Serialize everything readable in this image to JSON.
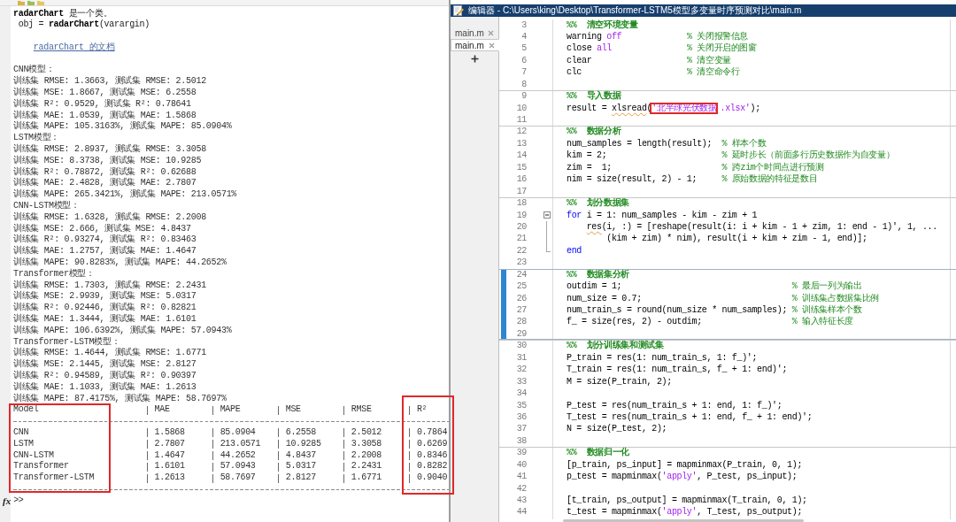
{
  "command_window": {
    "help": [
      {
        "kind": "heading",
        "text": "**radarChart** 是一个类。"
      },
      {
        "kind": "signature",
        "text": "obj = **radarChart**(varargin)"
      },
      {
        "kind": "link",
        "text": "radarChart 的文档"
      }
    ],
    "results": [
      {
        "title": "CNN模型：",
        "lines": [
          "训练集 RMSE: 1.3663, 测试集 RMSE: 2.5012",
          "训练集 MSE: 1.8667, 测试集 MSE: 6.2558",
          "训练集 R²: 0.9529, 测试集 R²: 0.78641",
          "训练集 MAE: 1.0539, 测试集 MAE: 1.5868",
          "训练集 MAPE: 105.3163%, 测试集 MAPE: 85.0904%"
        ]
      },
      {
        "title": "LSTM模型：",
        "lines": [
          "训练集 RMSE: 2.8937, 测试集 RMSE: 3.3058",
          "训练集 MSE: 8.3738, 测试集 MSE: 10.9285",
          "训练集 R²: 0.78872, 测试集 R²: 0.62688",
          "训练集 MAE: 2.4828, 测试集 MAE: 2.7807",
          "训练集 MAPE: 265.3421%, 测试集 MAPE: 213.0571%"
        ]
      },
      {
        "title": "CNN-LSTM模型：",
        "lines": [
          "训练集 RMSE: 1.6328, 测试集 RMSE: 2.2008",
          "训练集 MSE: 2.666, 测试集 MSE: 4.8437",
          "训练集 R²: 0.93274, 测试集 R²: 0.83463",
          "训练集 MAE: 1.2757, 测试集 MAE: 1.4647",
          "训练集 MAPE: 90.8283%, 测试集 MAPE: 44.2652%"
        ]
      },
      {
        "title": "Transformer模型：",
        "lines": [
          "训练集 RMSE: 1.7303, 测试集 RMSE: 2.2431",
          "训练集 MSE: 2.9939, 测试集 MSE: 5.0317",
          "训练集 R²: 0.92446, 测试集 R²: 0.82821",
          "训练集 MAE: 1.3444, 测试集 MAE: 1.6101",
          "训练集 MAPE: 106.6392%, 测试集 MAPE: 57.0943%"
        ]
      },
      {
        "title": "Transformer-LSTM模型：",
        "lines": [
          "训练集 RMSE: 1.4644, 测试集 RMSE: 1.6771",
          "训练集 MSE: 2.1445, 测试集 MSE: 2.8127",
          "训练集 R²: 0.94589, 测试集 R²: 0.90397",
          "训练集 MAE: 1.1033, 测试集 MAE: 1.2613",
          "训练集 MAPE: 87.4175%, 测试集 MAPE: 58.7697%"
        ]
      }
    ],
    "table": {
      "columns": [
        {
          "label": "Model",
          "highlighted": true
        },
        {
          "label": "MAE",
          "highlighted": false
        },
        {
          "label": "MAPE",
          "highlighted": false
        },
        {
          "label": "MSE",
          "highlighted": false
        },
        {
          "label": "RMSE",
          "highlighted": false
        },
        {
          "label": "R²",
          "highlighted": true
        }
      ],
      "rows": [
        [
          "CNN",
          "1.5868",
          "85.0904",
          "6.2558",
          "2.5012",
          "0.7864"
        ],
        [
          "LSTM",
          "2.7807",
          "213.0571",
          "10.9285",
          "3.3058",
          "0.6269"
        ],
        [
          "CNN-LSTM",
          "1.4647",
          "44.2652",
          "4.8437",
          "2.2008",
          "0.8346"
        ],
        [
          "Transformer",
          "1.6101",
          "57.0943",
          "5.0317",
          "2.2431",
          "0.8282"
        ],
        [
          "Transformer-LSTM",
          "1.2613",
          "58.7697",
          "2.8127",
          "1.6771",
          "0.9040"
        ]
      ]
    },
    "prompt": {
      "button": "fx",
      "text": ">>"
    }
  },
  "editor": {
    "title": "编辑器 - C:\\Users\\king\\Desktop\\Transformer-LSTM5模型多变量时序预测对比\\main.m",
    "tabs": [
      {
        "label": "main.m",
        "selected": false
      },
      {
        "label": "main.m",
        "selected": true
      }
    ],
    "cells": [
      {
        "active": false,
        "lines": [
          {
            "number": "3",
            "code": [
              {
                "kind": "section",
                "text": "%%  清空环境变量"
              }
            ]
          },
          {
            "number": "4",
            "code": [
              {
                "kind": "plain",
                "text": "warning "
              },
              {
                "kind": "string",
                "text": "off             "
              },
              {
                "kind": "comment",
                "text": "% 关闭报警信息"
              }
            ]
          },
          {
            "number": "5",
            "code": [
              {
                "kind": "plain",
                "text": "close "
              },
              {
                "kind": "string",
                "text": "all               "
              },
              {
                "kind": "comment",
                "text": "% 关闭开启的图窗"
              }
            ]
          },
          {
            "number": "6",
            "code": [
              {
                "kind": "plain",
                "text": "clear                   "
              },
              {
                "kind": "comment",
                "text": "% 清空变量"
              }
            ]
          },
          {
            "number": "7",
            "code": [
              {
                "kind": "plain",
                "text": "clc                     "
              },
              {
                "kind": "comment",
                "text": "% 清空命令行"
              }
            ]
          },
          {
            "number": "8"
          }
        ]
      },
      {
        "active": false,
        "lines": [
          {
            "number": "9",
            "code": [
              {
                "kind": "section",
                "text": "%%  导入数据"
              }
            ]
          },
          {
            "number": "10",
            "code": [
              {
                "kind": "plain",
                "text": "result = "
              },
              {
                "kind": "plain",
                "text": "xlsread",
                "warning": true
              },
              {
                "kind": "plain",
                "text": "("
              },
              {
                "kind": "string",
                "text": "'北半球光伏数据",
                "highlighted": true
              },
              {
                "kind": "string",
                "text": ".xlsx'"
              },
              {
                "kind": "plain",
                "text": ");"
              }
            ]
          },
          {
            "number": "11"
          }
        ]
      },
      {
        "active": false,
        "lines": [
          {
            "number": "12",
            "code": [
              {
                "kind": "section",
                "text": "%%  数据分析"
              }
            ]
          },
          {
            "number": "13",
            "code": [
              {
                "kind": "plain",
                "text": "num_samples = length(result);  "
              },
              {
                "kind": "comment",
                "text": "% 样本个数"
              }
            ]
          },
          {
            "number": "14",
            "code": [
              {
                "kind": "plain",
                "text": "kim = 2;                       "
              },
              {
                "kind": "comment",
                "text": "% 延时步长（前面多行历史数据作为自变量）"
              }
            ]
          },
          {
            "number": "15",
            "code": [
              {
                "kind": "plain",
                "text": "zim =  1;                      "
              },
              {
                "kind": "comment",
                "text": "% 跨zim个时间点进行预测"
              }
            ]
          },
          {
            "number": "16",
            "code": [
              {
                "kind": "plain",
                "text": "nim = size(result, 2) - 1;     "
              },
              {
                "kind": "comment",
                "text": "% 原始数据的特征是数目"
              }
            ]
          },
          {
            "number": "17"
          }
        ]
      },
      {
        "active": false,
        "lines": [
          {
            "number": "18",
            "code": [
              {
                "kind": "section",
                "text": "%%  划分数据集"
              }
            ]
          },
          {
            "number": "19",
            "expanded": true,
            "code": [
              {
                "kind": "keyword",
                "text": "for"
              },
              {
                "kind": "plain",
                "text": " i = 1: num_samples - kim - zim + 1"
              }
            ],
            "children": [
              {
                "number": "20",
                "code": [
                  {
                    "kind": "plain",
                    "text": "    res",
                    "warning": true
                  },
                  {
                    "kind": "plain",
                    "text": "(i, :) = [reshape(result(i: i + kim - 1 + zim, 1: end - 1)', 1, ..."
                  }
                ]
              },
              {
                "number": "21",
                "code": [
                  {
                    "kind": "plain",
                    "text": "        (kim + zim) * nim), result(i + kim + zim - 1, end)];"
                  }
                ]
              },
              {
                "number": "22",
                "code": [
                  {
                    "kind": "keyword",
                    "text": "end"
                  }
                ]
              }
            ]
          },
          {
            "number": "23"
          }
        ]
      },
      {
        "active": true,
        "lines": [
          {
            "number": "24",
            "code": [
              {
                "kind": "section",
                "text": "%%  数据集分析"
              }
            ]
          },
          {
            "number": "25",
            "code": [
              {
                "kind": "plain",
                "text": "outdim = 1;                                  "
              },
              {
                "kind": "comment",
                "text": "% 最后一列为输出"
              }
            ]
          },
          {
            "number": "26",
            "code": [
              {
                "kind": "plain",
                "text": "num_size = 0.7;                              "
              },
              {
                "kind": "comment",
                "text": "% 训练集占数据集比例"
              }
            ]
          },
          {
            "number": "27",
            "code": [
              {
                "kind": "plain",
                "text": "num_train_s = round(num_size * num_samples); "
              },
              {
                "kind": "comment",
                "text": "% 训练集样本个数"
              }
            ]
          },
          {
            "number": "28",
            "code": [
              {
                "kind": "plain",
                "text": "f_ = size(res, 2) - outdim;                  "
              },
              {
                "kind": "comment",
                "text": "% 输入特征长度"
              }
            ]
          },
          {
            "number": "29"
          }
        ]
      },
      {
        "active": false,
        "lines": [
          {
            "number": "30",
            "code": [
              {
                "kind": "section",
                "text": "%%  划分训练集和测试集"
              }
            ]
          },
          {
            "number": "31",
            "code": [
              {
                "kind": "plain",
                "text": "P_train = res(1: num_train_s, 1: f_)';"
              }
            ]
          },
          {
            "number": "32",
            "code": [
              {
                "kind": "plain",
                "text": "T_train = res(1: num_train_s, f_ + 1: end)';"
              }
            ]
          },
          {
            "number": "33",
            "code": [
              {
                "kind": "plain",
                "text": "M = size(P_train, 2);"
              }
            ]
          },
          {
            "number": "34"
          },
          {
            "number": "35",
            "code": [
              {
                "kind": "plain",
                "text": "P_test = res(num_train_s + 1: end, 1: f_)';"
              }
            ]
          },
          {
            "number": "36",
            "code": [
              {
                "kind": "plain",
                "text": "T_test = res(num_train_s + 1: end, f_ + 1: end)';"
              }
            ]
          },
          {
            "number": "37",
            "code": [
              {
                "kind": "plain",
                "text": "N = size(P_test, 2);"
              }
            ]
          },
          {
            "number": "38"
          }
        ]
      },
      {
        "active": false,
        "lines": [
          {
            "number": "39",
            "code": [
              {
                "kind": "section",
                "text": "%%  数据归一化"
              }
            ]
          },
          {
            "number": "40",
            "code": [
              {
                "kind": "plain",
                "text": "[p_train, ps_input] = mapminmax(P_train, 0, 1);"
              }
            ]
          },
          {
            "number": "41",
            "code": [
              {
                "kind": "plain",
                "text": "p_test = mapminmax("
              },
              {
                "kind": "string",
                "text": "'apply'"
              },
              {
                "kind": "plain",
                "text": ", P_test, ps_input);"
              }
            ]
          },
          {
            "number": "42"
          },
          {
            "number": "43",
            "code": [
              {
                "kind": "plain",
                "text": "[t_train, ps_output] = mapminmax(T_train, 0, 1);"
              }
            ]
          },
          {
            "number": "44",
            "code": [
              {
                "kind": "plain",
                "text": "t_test = mapminmax("
              },
              {
                "kind": "string",
                "text": "'apply'"
              },
              {
                "kind": "plain",
                "text": ", T_test, ps_output);"
              }
            ]
          }
        ]
      }
    ]
  }
}
